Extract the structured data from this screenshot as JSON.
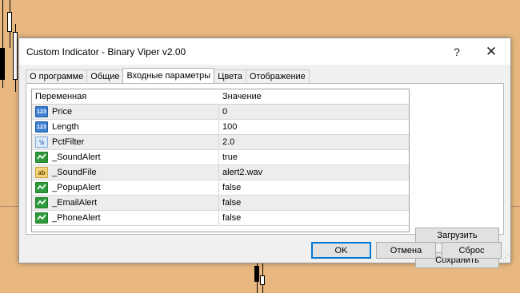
{
  "dialog": {
    "title": "Custom Indicator - Binary Viper v2.00",
    "help_label": "?",
    "close_label": "✕"
  },
  "tabs": [
    {
      "label": "О программе"
    },
    {
      "label": "Общие"
    },
    {
      "label": "Входные параметры",
      "active": true
    },
    {
      "label": "Цвета"
    },
    {
      "label": "Отображение"
    }
  ],
  "table": {
    "headers": {
      "variable": "Переменная",
      "value": "Значение"
    },
    "rows": [
      {
        "variable": "Price",
        "value": "0",
        "icon": "int-icon",
        "icon_text": "123"
      },
      {
        "variable": "Length",
        "value": "100",
        "icon": "int-icon",
        "icon_text": "123"
      },
      {
        "variable": "PctFilter",
        "value": "2.0",
        "icon": "double-icon",
        "icon_text": "½"
      },
      {
        "variable": "_SoundAlert",
        "value": "true",
        "icon": "bool-icon",
        "icon_text": ""
      },
      {
        "variable": "_SoundFile",
        "value": "alert2.wav",
        "icon": "string-icon",
        "icon_text": "ab"
      },
      {
        "variable": "_PopupAlert",
        "value": "false",
        "icon": "bool-icon",
        "icon_text": ""
      },
      {
        "variable": "_EmailAlert",
        "value": "false",
        "icon": "bool-icon",
        "icon_text": ""
      },
      {
        "variable": "_PhoneAlert",
        "value": "false",
        "icon": "bool-icon",
        "icon_text": ""
      }
    ]
  },
  "side_buttons": {
    "load": "Загрузить",
    "save": "Сохранить"
  },
  "footer_buttons": {
    "ok": "OK",
    "cancel": "Отмена",
    "reset": "Сброс"
  },
  "colors": {
    "chart_background": "#E8B880",
    "accent": "#0078D7"
  }
}
